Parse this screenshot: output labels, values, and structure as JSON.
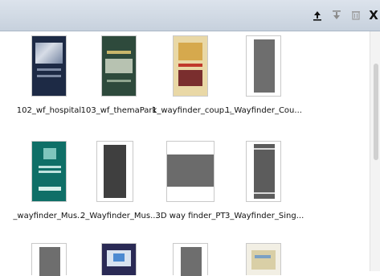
{
  "toolbar": {
    "icons": [
      "upload-icon",
      "download-icon",
      "trash-icon",
      "close-icon"
    ],
    "close_label": "X"
  },
  "files": [
    {
      "name": "102_wf_hospital",
      "thumb": "photo-dark-blue"
    },
    {
      "name": "103_wf_themaPark",
      "thumb": "photo-dark-green"
    },
    {
      "name": "1_wayfinder_coup...",
      "thumb": "photo-colorful"
    },
    {
      "name": "1_Wayfinder_Cou...",
      "thumb": "gray-panel"
    },
    {
      "name": "_wayfinder_Mus...",
      "thumb": "photo-teal"
    },
    {
      "name": "2_Wayfinder_Mus...",
      "thumb": "dark-gray-panel"
    },
    {
      "name": "3D way finder_PT",
      "thumb": "landscape-gray"
    },
    {
      "name": "3_Wayfinder_Sing...",
      "thumb": "gray-striped-panel"
    }
  ],
  "colors": {
    "toolbar_bg": "#c7d1dd",
    "panel_gray": "#6e6e6e",
    "dark_panel": "#3f3f3f"
  }
}
